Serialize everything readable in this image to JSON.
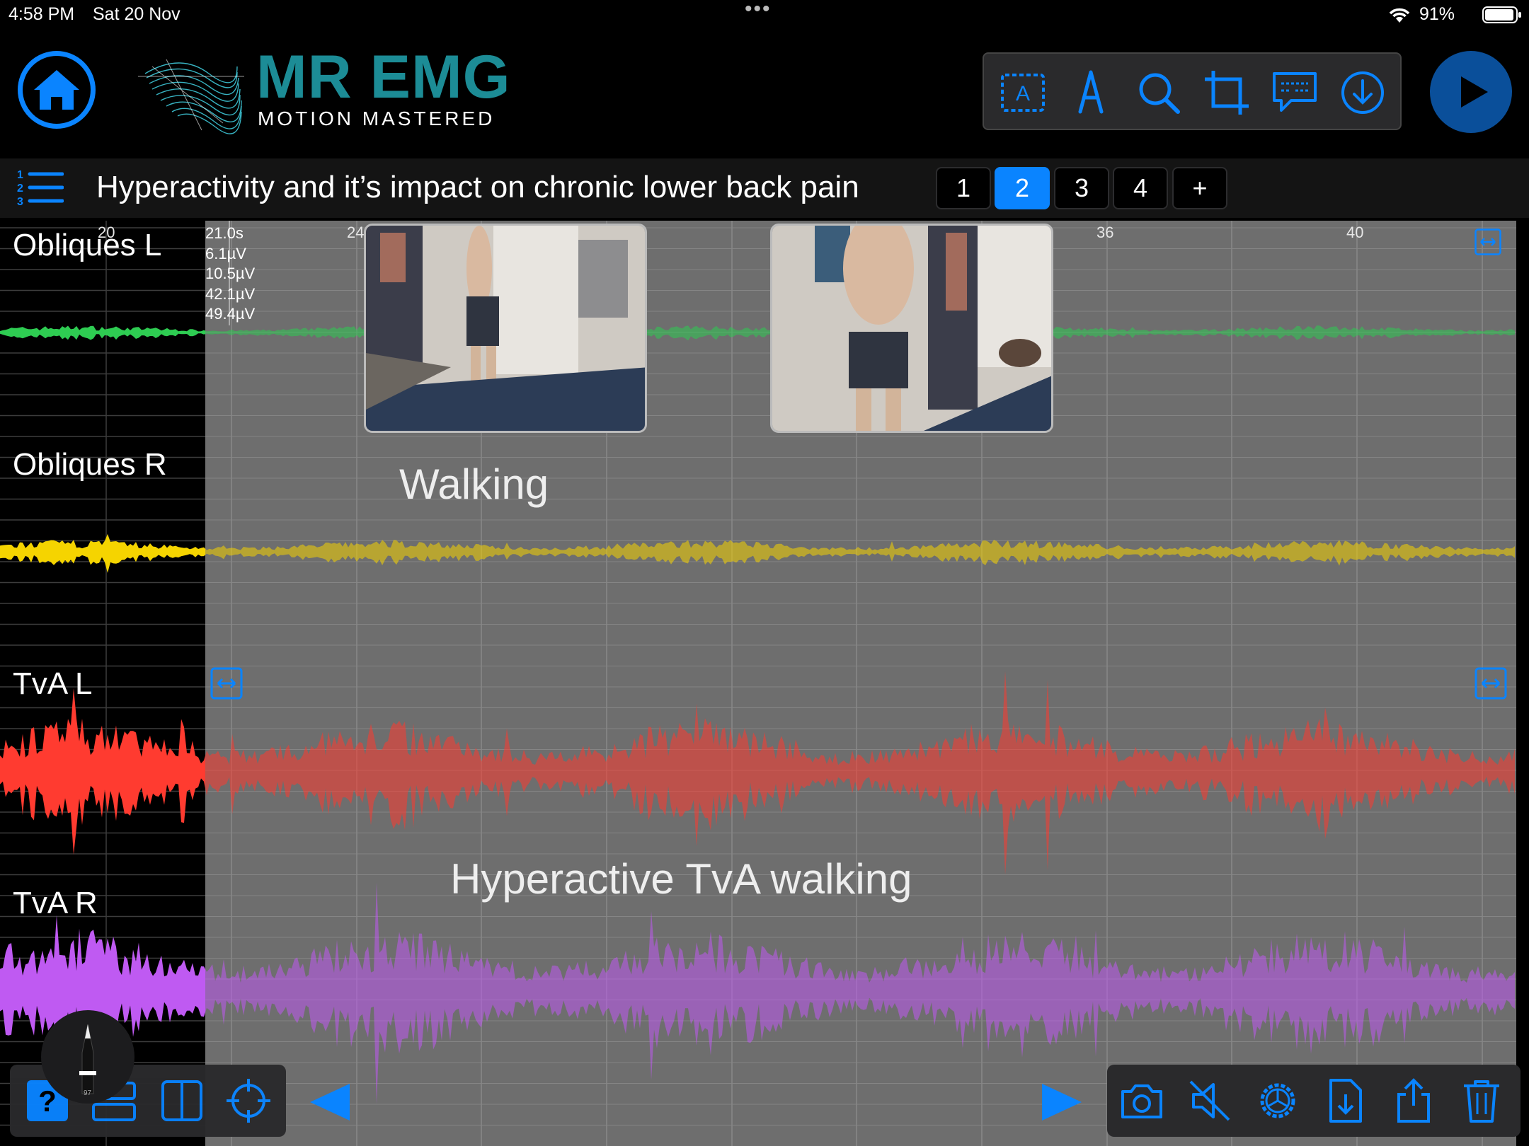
{
  "status": {
    "time": "4:58 PM",
    "date": "Sat 20 Nov",
    "dots": "•••",
    "battery": "91%"
  },
  "brand": {
    "title": "MR EMG",
    "subtitle": "MOTION MASTERED"
  },
  "toolbar": {
    "icons": [
      "text-box-icon",
      "pen-icon",
      "search-icon",
      "crop-icon",
      "comment-icon",
      "download-icon"
    ]
  },
  "title_bar": {
    "title": "Hyperactivity and it’s impact on chronic lower back pain",
    "pages": [
      "1",
      "2",
      "3",
      "4",
      "+"
    ],
    "active_page": "2"
  },
  "chart": {
    "time_ticks": [
      "20",
      "24",
      "36",
      "40"
    ],
    "readout": [
      "21.0s",
      "6.1µV",
      "10.5µV",
      "42.1µV",
      "49.4µV"
    ],
    "channels": [
      {
        "name": "Obliques L",
        "color": "#2ecc52"
      },
      {
        "name": "Obliques R",
        "color": "#f5d400"
      },
      {
        "name": "TvA L",
        "color": "#ff3b30"
      },
      {
        "name": "TvA R",
        "color": "#bf5af2"
      }
    ],
    "annotations": [
      "Walking",
      "Hyperactive TvA walking"
    ]
  },
  "bottom": {
    "left_icons": [
      "help-icon",
      "layout-icon",
      "split-view-icon",
      "crosshair-icon",
      "prev-arrow-icon"
    ],
    "right_icons": [
      "next-arrow-icon",
      "camera-icon",
      "mute-icon",
      "settings-icon",
      "file-download-icon",
      "share-icon",
      "trash-icon"
    ],
    "pen_badge": "97"
  },
  "accent": "#0a84ff"
}
